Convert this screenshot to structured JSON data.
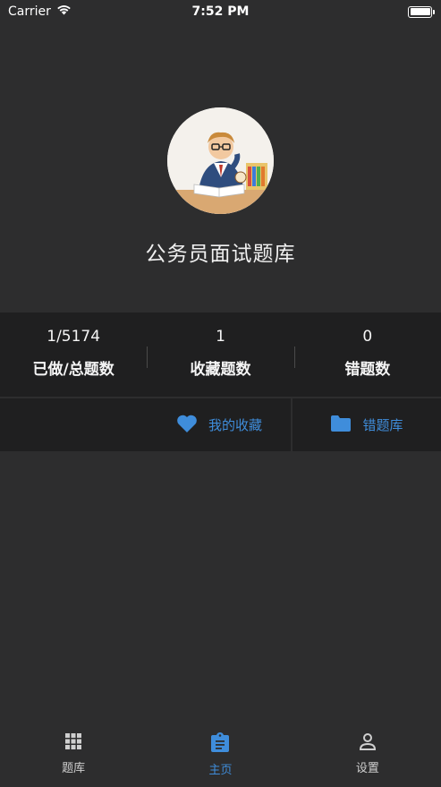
{
  "status_bar": {
    "carrier": "Carrier",
    "time": "7:52 PM"
  },
  "hero": {
    "title": "公务员面试题库"
  },
  "stats": [
    {
      "value": "1/5174",
      "label": "已做/总题数"
    },
    {
      "value": "1",
      "label": "收藏题数"
    },
    {
      "value": "0",
      "label": "错题数"
    }
  ],
  "actions": {
    "favorites_label": "我的收藏",
    "wrong_label": "错题库"
  },
  "tabs": [
    {
      "label": "题库",
      "icon": "grid-icon",
      "active": false
    },
    {
      "label": "主页",
      "icon": "clipboard-icon",
      "active": true
    },
    {
      "label": "设置",
      "icon": "person-icon",
      "active": false
    }
  ],
  "colors": {
    "background": "#2d2d2e",
    "panel": "#1f1f20",
    "accent": "#3f8ddb"
  }
}
